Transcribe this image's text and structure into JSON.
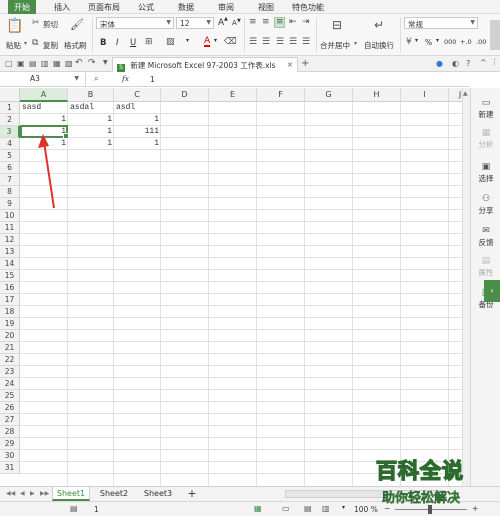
{
  "menu": {
    "tabs": [
      "开始",
      "插入",
      "页面布局",
      "公式",
      "数据",
      "审阅",
      "视图",
      "特色功能"
    ]
  },
  "ribbon": {
    "paste": "粘贴",
    "cut": "剪切",
    "copy": "复制",
    "format_painter": "格式刷",
    "font_name": "宋体",
    "font_size": "12",
    "merge_center": "合并居中",
    "wrap_text": "自动换行",
    "number_format": "常规",
    "percent": "%",
    "bold": "B",
    "italic": "I",
    "underline": "U",
    "grow_font": "A",
    "shrink_font": "A"
  },
  "file_tab": {
    "title": "新建 Microsoft Excel 97-2003 工作表.xls"
  },
  "formula_bar": {
    "cell_ref": "A3",
    "fx": "fx",
    "value": "1"
  },
  "grid": {
    "columns": [
      "A",
      "B",
      "C",
      "D",
      "E",
      "F",
      "G",
      "H",
      "I",
      "J"
    ],
    "rows": [
      "1",
      "2",
      "3",
      "4",
      "5",
      "6",
      "7",
      "8",
      "9",
      "10",
      "11",
      "12",
      "13",
      "14",
      "15",
      "16",
      "17",
      "18",
      "19",
      "20",
      "21",
      "22",
      "23",
      "24",
      "25",
      "26",
      "27",
      "28",
      "29",
      "30",
      "31"
    ],
    "cells": {
      "A1": "sasd",
      "B1": "asdal",
      "C1": "asdl",
      "A2": "1",
      "B2": "1",
      "C2": "1",
      "A3": "1",
      "B3": "1",
      "C3": "111",
      "A4": "1",
      "B4": "1",
      "C4": "1"
    },
    "selected_cell": "A3"
  },
  "right_panel": {
    "items": [
      "新建",
      "分析",
      "选择",
      "分享",
      "反馈",
      "属性",
      "备份"
    ]
  },
  "sheets": {
    "tabs": [
      "Sheet1",
      "Sheet2",
      "Sheet3"
    ],
    "add": "+"
  },
  "status": {
    "sum_value": "1",
    "zoom": "100 %",
    "zoom_minus": "−",
    "zoom_plus": "+"
  },
  "watermark": {
    "main": "百科全说",
    "sub": "助你轻松解决"
  },
  "colors": {
    "accent": "#4b8e47",
    "annotation": "#e0302a"
  }
}
